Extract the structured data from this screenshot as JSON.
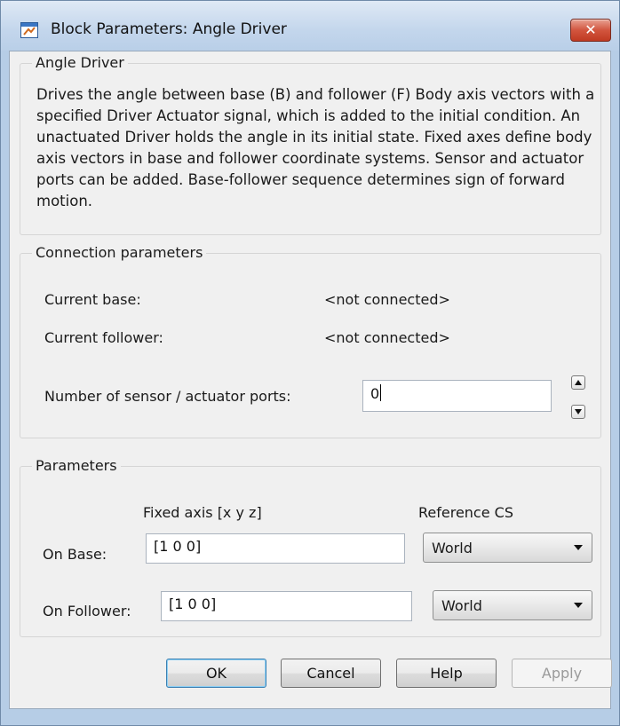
{
  "window": {
    "title": "Block Parameters: Angle Driver",
    "close_label": "✕"
  },
  "block": {
    "name": "Angle Driver",
    "description": "Drives the angle between base (B) and follower (F) Body axis vectors with a specified Driver Actuator signal, which is added to the initial condition. An unactuated Driver holds the angle in its initial state. Fixed axes define body axis vectors in base and follower coordinate systems. Sensor and actuator ports can be added. Base-follower sequence determines sign of forward motion."
  },
  "connection": {
    "title": "Connection parameters",
    "current_base_label": "Current base:",
    "current_base_value": "<not connected>",
    "current_follower_label": "Current follower:",
    "current_follower_value": "<not connected>",
    "ports_label": "Number of sensor / actuator ports:",
    "ports_value": "0"
  },
  "parameters": {
    "title": "Parameters",
    "fixed_axis_header": "Fixed axis [x y z]",
    "reference_cs_header": "Reference CS",
    "on_base_label": "On Base:",
    "on_base_axis": "[1 0 0]",
    "on_base_cs": "World",
    "on_follower_label": "On Follower:",
    "on_follower_axis": "[1 0 0]",
    "on_follower_cs": "World"
  },
  "buttons": {
    "ok": "OK",
    "cancel": "Cancel",
    "help": "Help",
    "apply": "Apply"
  },
  "icons": {
    "app": "block-parameters-icon",
    "close": "close-icon",
    "spin_up": "spin-up-icon",
    "spin_down": "spin-down-icon",
    "dropdown": "chevron-down-icon"
  },
  "colors": {
    "close_button": "#c8452d",
    "titlebar": "#c3d6ec",
    "dialog_background": "#f0f0f0",
    "default_button_border": "#3c7fb1"
  }
}
